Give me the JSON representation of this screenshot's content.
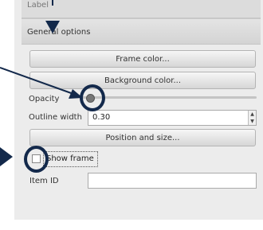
{
  "panel": {
    "label_tab": "Label",
    "section_title": "General options",
    "frame_color_button": "Frame color...",
    "background_color_button": "Background color...",
    "opacity_label": "Opacity",
    "opacity_value": 0.05,
    "outline_width_label": "Outline width",
    "outline_width_value": "0.30",
    "position_size_button": "Position and size...",
    "show_frame_label": "Show frame",
    "show_frame_checked": false,
    "item_id_label": "Item ID",
    "item_id_value": ""
  },
  "annotations": {
    "color": "#13294b"
  }
}
